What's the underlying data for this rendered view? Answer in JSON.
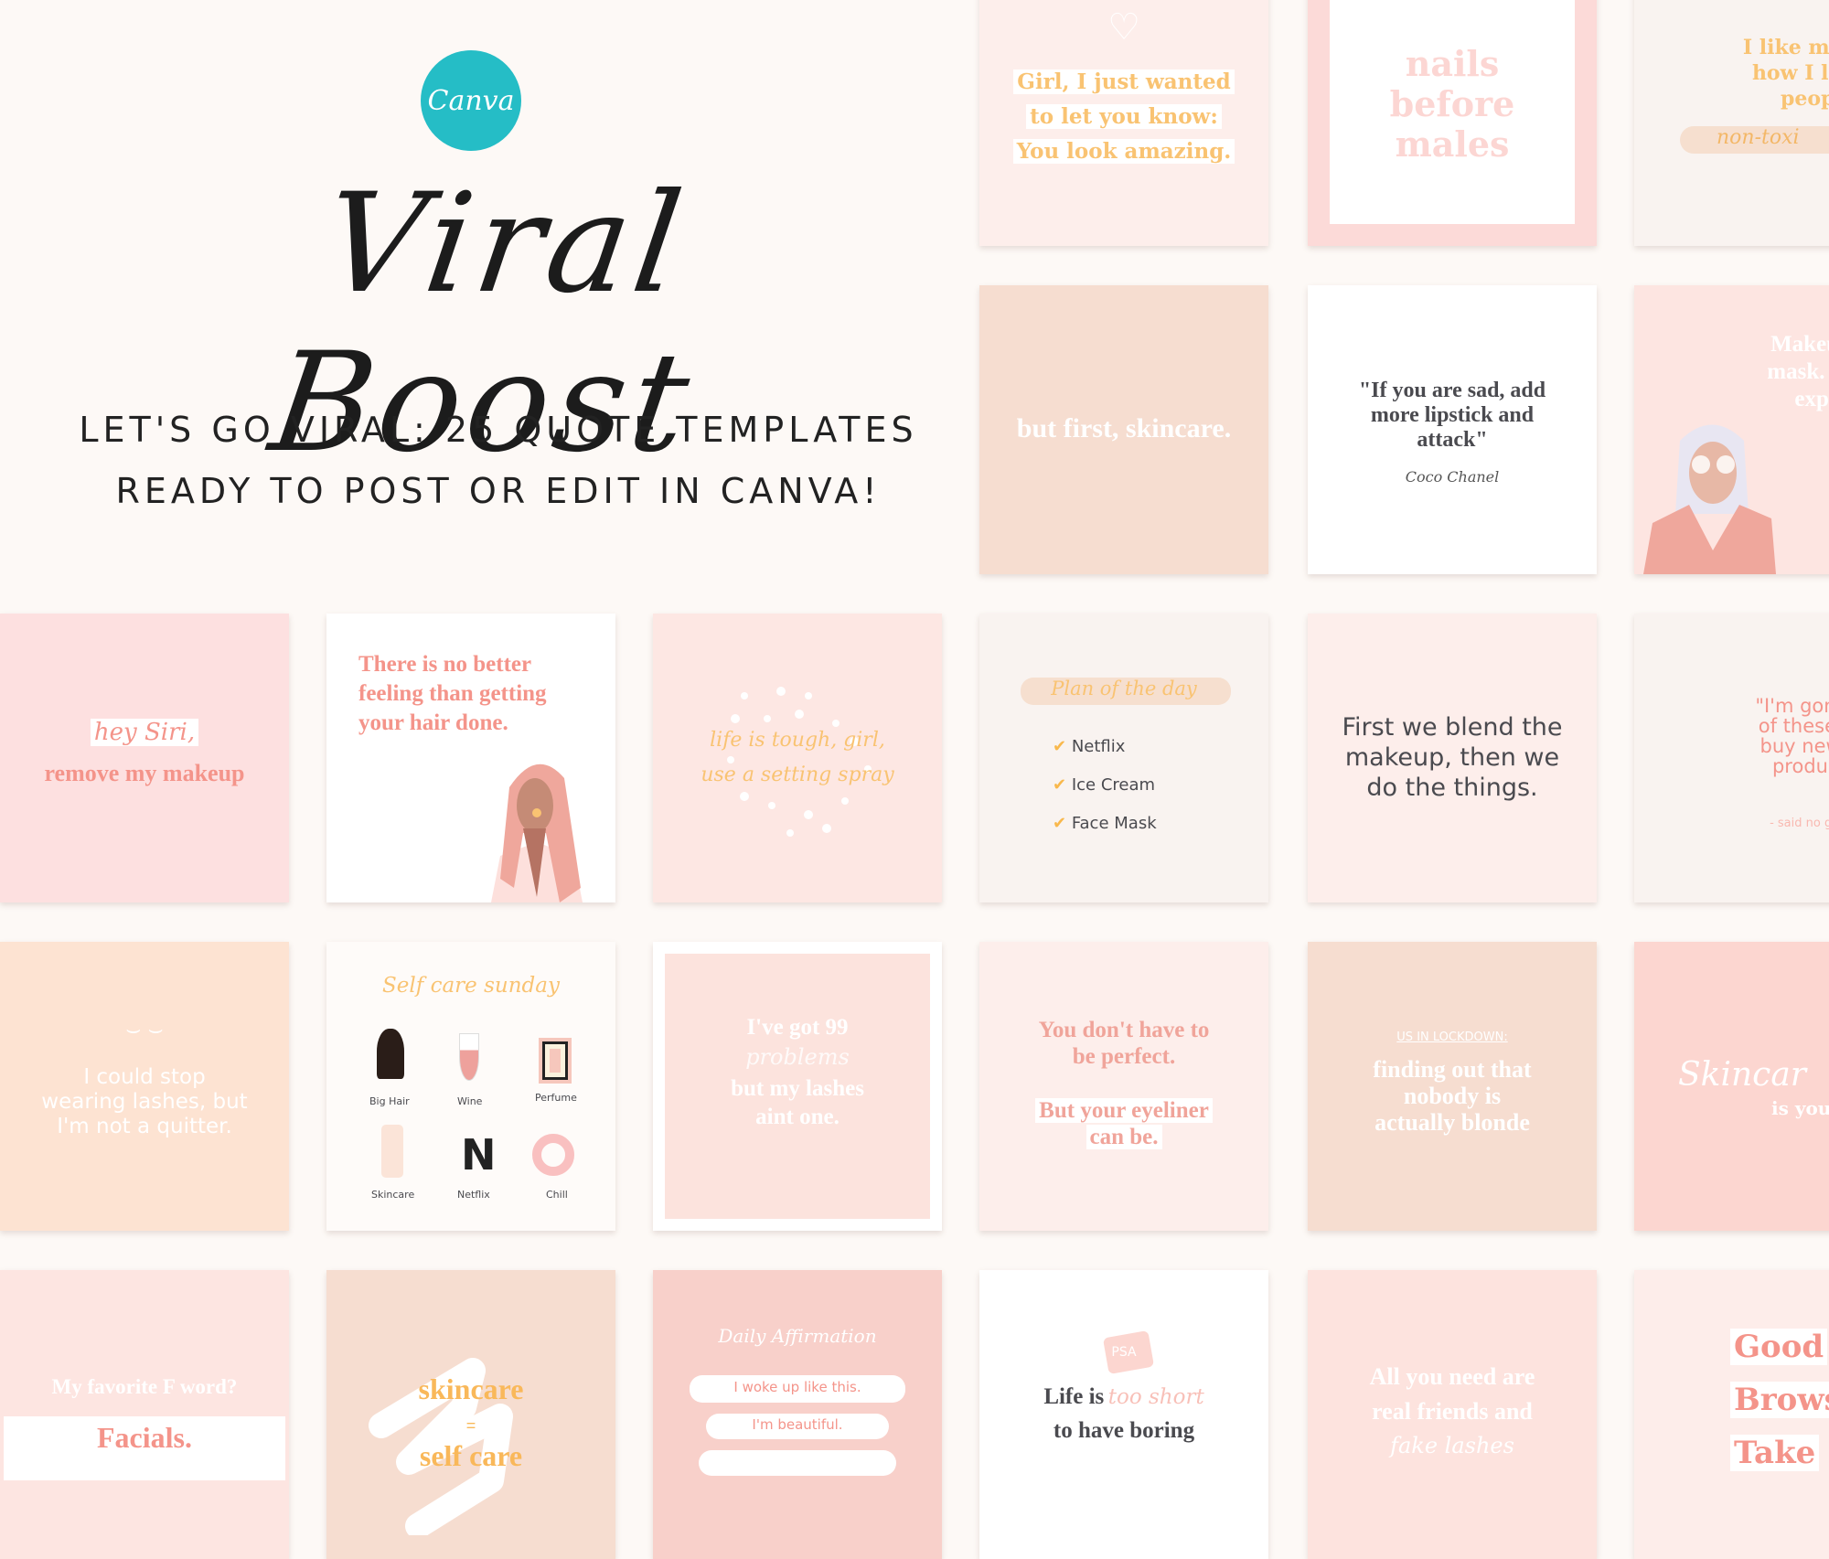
{
  "hero": {
    "logo_text": "Canva",
    "title": "Viral Boost",
    "subtitle_line1": "LET'S GO VIRAL:  25 QUOTE TEMPLATES",
    "subtitle_line2": "READY TO POST OR EDIT IN CANVA!"
  },
  "colors": {
    "page_bg": "#fdf9f6",
    "canva_teal": "#25bdc6",
    "peach_text": "#f9c372",
    "coral_text": "#f4948a",
    "dark_text": "#4a4a4f"
  },
  "tiles": {
    "girl_amazing": {
      "lines": [
        "Girl, I just wanted",
        "to let you know:",
        "You look amazing."
      ]
    },
    "nails": {
      "lines": [
        "nails",
        "before",
        "males"
      ]
    },
    "products": {
      "lines": [
        "I like my prod",
        "how I like m",
        "people:"
      ],
      "script": "non-toxi"
    },
    "skincare_first": {
      "text": "but first, skincare."
    },
    "chanel": {
      "quote": [
        "\"If you are sad, add",
        "more lipstick and",
        "attack\""
      ],
      "author": "Coco Chanel"
    },
    "makeup_mask": {
      "lines": [
        "Makeup is",
        "mask. Mak",
        "expre"
      ]
    },
    "siri": {
      "script": "hey Siri,",
      "text": "remove my makeup"
    },
    "hair_done": {
      "lines": [
        "There is no better",
        "feeling than getting",
        "your hair done."
      ]
    },
    "life_tough": {
      "lines": [
        "life is tough, girl,",
        "use a setting spray"
      ]
    },
    "plan_day": {
      "title": "Plan of the day",
      "items": [
        "Netflix",
        "Ice Cream",
        "Face Mask"
      ]
    },
    "blend": {
      "lines": [
        "First we blend the",
        "makeup, then we",
        "do the things."
      ]
    },
    "gonna_use": {
      "lines": [
        "\"I'm gonna us",
        "of these befo",
        "buy new bea",
        "products.\""
      ],
      "attrib": "- said no girl ever"
    },
    "lashes_quitter": {
      "lines": [
        "I could stop",
        "wearing lashes, but",
        "I'm not a quitter."
      ]
    },
    "self_care_sunday": {
      "title": "Self care sunday",
      "items": [
        "Big Hair",
        "Wine",
        "Perfume",
        "Skincare",
        "Netflix",
        "Chill"
      ]
    },
    "problems": {
      "line1": "I've got 99",
      "script": "problems",
      "line2": "but my lashes",
      "line3": "aint one."
    },
    "perfect": {
      "lines": [
        "You don't have to",
        "be perfect."
      ],
      "highlight": [
        "But your eyeliner",
        "can be."
      ]
    },
    "lockdown": {
      "label": "US IN LOCKDOWN:",
      "lines": [
        "finding out that",
        "nobody is",
        "actually blonde"
      ]
    },
    "skincare_is": {
      "script": "Skincar",
      "text": "is you"
    },
    "f_word": {
      "question": "My favorite F word?",
      "answer": "Facials."
    },
    "skincare_eq": {
      "top": "skincare",
      "eq": "=",
      "bottom": "self care"
    },
    "affirmation": {
      "title": "Daily Affirmation",
      "items": [
        "I woke up like this.",
        "I'm beautiful."
      ]
    },
    "psa": {
      "badge": "PSA",
      "line1a": "Life is",
      "script": "too short",
      "line2": "to have boring"
    },
    "friends": {
      "lines": [
        "All you need are",
        "real friends and"
      ],
      "script": "fake lashes"
    },
    "good_brows": {
      "lines": [
        "Good",
        "Brows",
        "Take"
      ]
    }
  }
}
